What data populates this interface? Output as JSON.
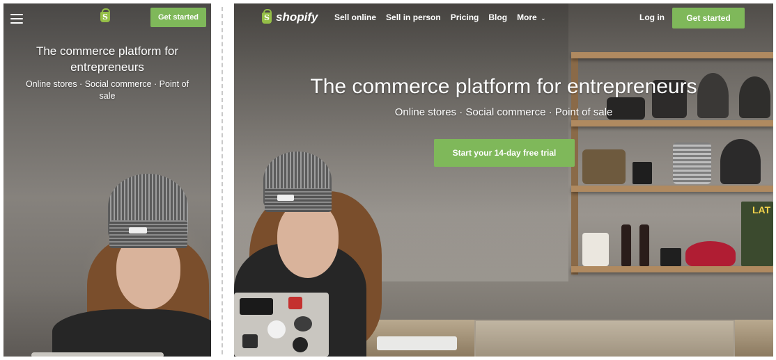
{
  "mobile": {
    "menu_icon": "hamburger-menu-icon",
    "logo_icon": "shopify-bag-icon",
    "logo_letter": "S",
    "cta_label": "Get started",
    "hero_title": "The commerce platform for entrepreneurs",
    "hero_subtitle": "Online stores · Social commerce · Point of sale"
  },
  "desktop": {
    "logo_icon": "shopify-bag-icon",
    "logo_letter": "S",
    "logo_text": "shopify",
    "nav_items": [
      "Sell online",
      "Sell in person",
      "Pricing",
      "Blog",
      "More"
    ],
    "more_icon": "chevron-down-icon",
    "login_label": "Log in",
    "cta_label": "Get started",
    "hero_title": "The commerce platform for entrepreneurs",
    "hero_subtitle": "Online stores · Social commerce · Point of sale",
    "trial_label": "Start your 14-day free trial",
    "shelf_sign": "LAT"
  },
  "colors": {
    "brand_green": "#95bf47",
    "button_green": "#7fb85a",
    "text_white": "#ffffff"
  }
}
